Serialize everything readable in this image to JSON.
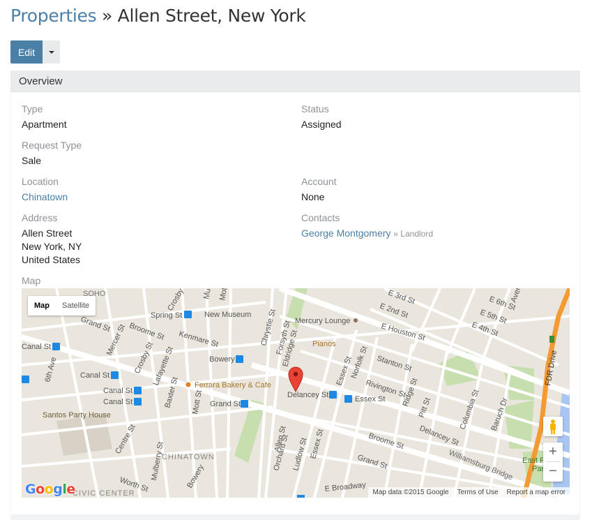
{
  "page": {
    "breadcrumb_link": "Properties",
    "separator": "»",
    "title": "Allen Street, New York"
  },
  "toolbar": {
    "edit_label": "Edit"
  },
  "panel": {
    "heading": "Overview"
  },
  "fields": {
    "type": {
      "label": "Type",
      "value": "Apartment"
    },
    "status": {
      "label": "Status",
      "value": "Assigned"
    },
    "request_type": {
      "label": "Request Type",
      "value": "Sale"
    },
    "location": {
      "label": "Location",
      "value": "Chinatown"
    },
    "account": {
      "label": "Account",
      "value": "None"
    },
    "address": {
      "label": "Address",
      "line1": "Allen Street",
      "line2": "New York, NY",
      "line3": "United States"
    },
    "contacts": {
      "label": "Contacts",
      "name": "George Montgomery",
      "role": "» Landlord"
    },
    "map": {
      "label": "Map"
    }
  },
  "map": {
    "type_map": "Map",
    "type_satellite": "Satellite",
    "zoom_in": "+",
    "zoom_out": "−",
    "logo": {
      "g": "G",
      "o1": "o",
      "o2": "o",
      "g2": "g",
      "l": "l",
      "e": "e"
    },
    "attribution": {
      "data": "Map data ©2015 Google",
      "terms": "Terms of Use",
      "report": "Report a map error"
    },
    "labels": {
      "soho": "SOHO",
      "spring_st_m": "Spring St",
      "new_museum": "New Museum",
      "mercury_lounge": "Mercury Lounge",
      "e_houston": "E Houston St",
      "pianos": "Pianos",
      "kenmare": "Kenmare St",
      "bowery_m": "Bowery",
      "canal_m1": "Canal St",
      "canal_m2": "Canal St",
      "canal_m3": "Canal St",
      "canal_m4": "Canal St",
      "ferrara": "Ferrara Bakery & Cafe",
      "delancey_m": "Delancey St",
      "essex_m": "Essex St",
      "grand_m": "Grand St",
      "santos": "Santos Party House",
      "chinatown": "CHINATOWN",
      "civic": "CIVIC CENTER",
      "e_broadway": "E Broadway",
      "williamsburg": "Williamsburg Bridge",
      "fdr": "FDR Drive",
      "broome": "Broome St",
      "grand": "Grand St",
      "delancey": "Delancey St",
      "stanton": "Stanton St",
      "rivington": "Rivington St",
      "allen": "Allen St",
      "orchard": "Orchard St",
      "ludlow": "Ludlow St",
      "essex": "Essex St",
      "norfolk": "Norfolk St",
      "eldridge": "Eldridge St",
      "chrystie": "Chrystie St",
      "forsyth": "Forsyth St",
      "mott": "Mott St",
      "mulberry": "Mulberry St",
      "centre": "Centre St",
      "lafayette": "Lafayette St",
      "crosby": "Crosby St",
      "baxter": "Baxter St",
      "mercer": "Mercer St",
      "grand_st_w": "Grand St",
      "broome_w": "Broome St",
      "ridge": "Ridge St",
      "pitt": "Pitt St",
      "columbia": "Columbia St",
      "baruch": "Baruch Dr",
      "e_2nd": "E 2nd St",
      "e_3rd": "E 3rd St",
      "e_4th": "E 4th St",
      "e_5th": "E 5th St",
      "e_6th": "E 6th St",
      "sixth_ave": "6th Ave",
      "east_river_park": "East River Park",
      "worth": "Worth St",
      "bowery": "Bowery",
      "mott_s": "Mott St",
      "eldridge_s": "Eldridge St",
      "st_s": "St",
      "avenue": "Avenue",
      "mulberry_n": "Mulb",
      "mott_n": "Mott",
      "crosby_n": "Crosby",
      "e_7th": "E",
      "e_5th_b": "E 5th St",
      "e_3rd_b": "E 3rd St",
      "east_river_park_b": "East R",
      "par": "Par",
      "route_5": "5"
    }
  }
}
